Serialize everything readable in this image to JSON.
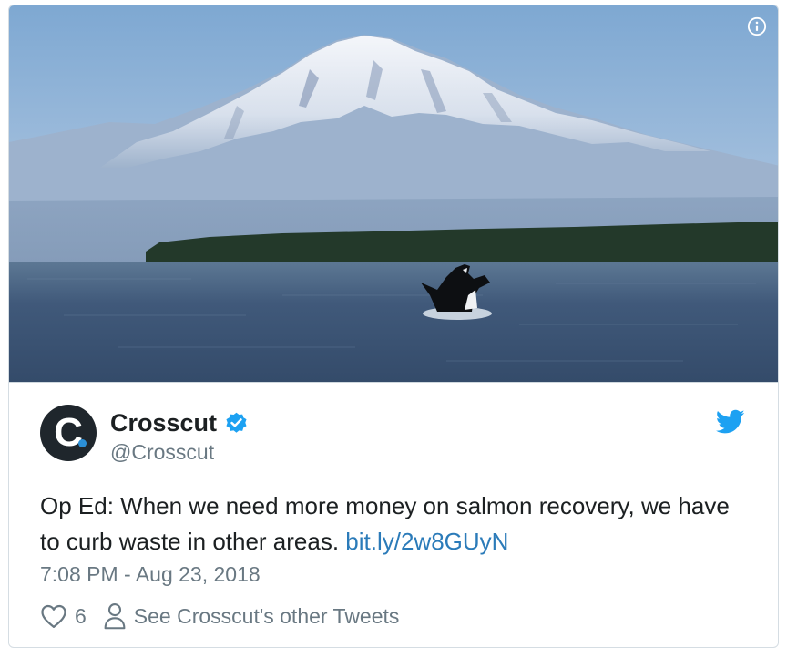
{
  "media": {
    "description_icon": "info-icon",
    "colors": {
      "sky_top": "#7fa9d1",
      "sky_bottom": "#bcd1e5",
      "water": "#3d5876",
      "forest": "#243a2a"
    }
  },
  "tweet": {
    "author": {
      "display_name": "Crosscut",
      "handle": "@Crosscut",
      "avatar_letter": "C",
      "verified_icon": "verified-badge-icon"
    },
    "text": "Op Ed: When we need more money on salmon recovery, we have to curb waste in other areas. ",
    "link_text": "bit.ly/2w8GUyN",
    "timestamp": "7:08 PM - Aug 23, 2018",
    "platform_icon": "twitter-bird-icon"
  },
  "actions": {
    "like_icon": "heart-icon",
    "like_count": "6",
    "profile_icon": "person-icon",
    "other_tweets_label": "See Crosscut's other Tweets"
  },
  "colors": {
    "link": "#2b7bb9",
    "verified": "#1da1f2",
    "muted": "#697882",
    "text": "#1c2022"
  }
}
